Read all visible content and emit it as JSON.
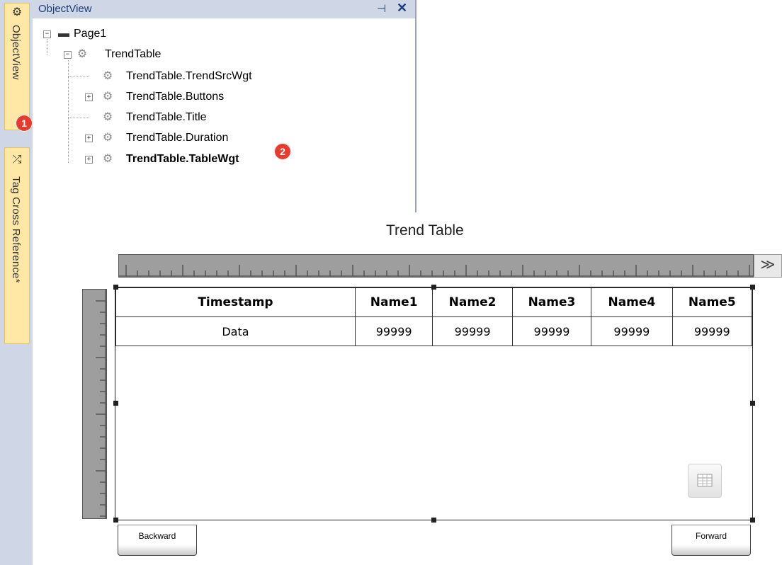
{
  "side_tabs": [
    {
      "label": "ObjectView",
      "icon": "puzzle-icon"
    },
    {
      "label": "Tag Cross Reference*",
      "icon": "shuffle-icon"
    }
  ],
  "badges": [
    "1",
    "2"
  ],
  "object_view": {
    "title": "ObjectView",
    "tree": [
      {
        "label": "Page1",
        "expander": "−"
      },
      {
        "label": "TrendTable",
        "expander": "−"
      },
      {
        "label": "TrendTable.TrendSrcWgt",
        "expander": ""
      },
      {
        "label": "TrendTable.Buttons",
        "expander": "+"
      },
      {
        "label": "TrendTable.Title",
        "expander": ""
      },
      {
        "label": "TrendTable.Duration",
        "expander": "+"
      },
      {
        "label": "TrendTable.TableWgt",
        "expander": "+"
      }
    ]
  },
  "canvas": {
    "title": "Trend Table",
    "scroll_right": "≫",
    "table": {
      "headers": [
        "Timestamp",
        "Name1",
        "Name2",
        "Name3",
        "Name4",
        "Name5"
      ],
      "row": [
        "Data",
        "99999",
        "99999",
        "99999",
        "99999",
        "99999"
      ]
    },
    "backward_label": "Backward",
    "forward_label": "Forward"
  }
}
